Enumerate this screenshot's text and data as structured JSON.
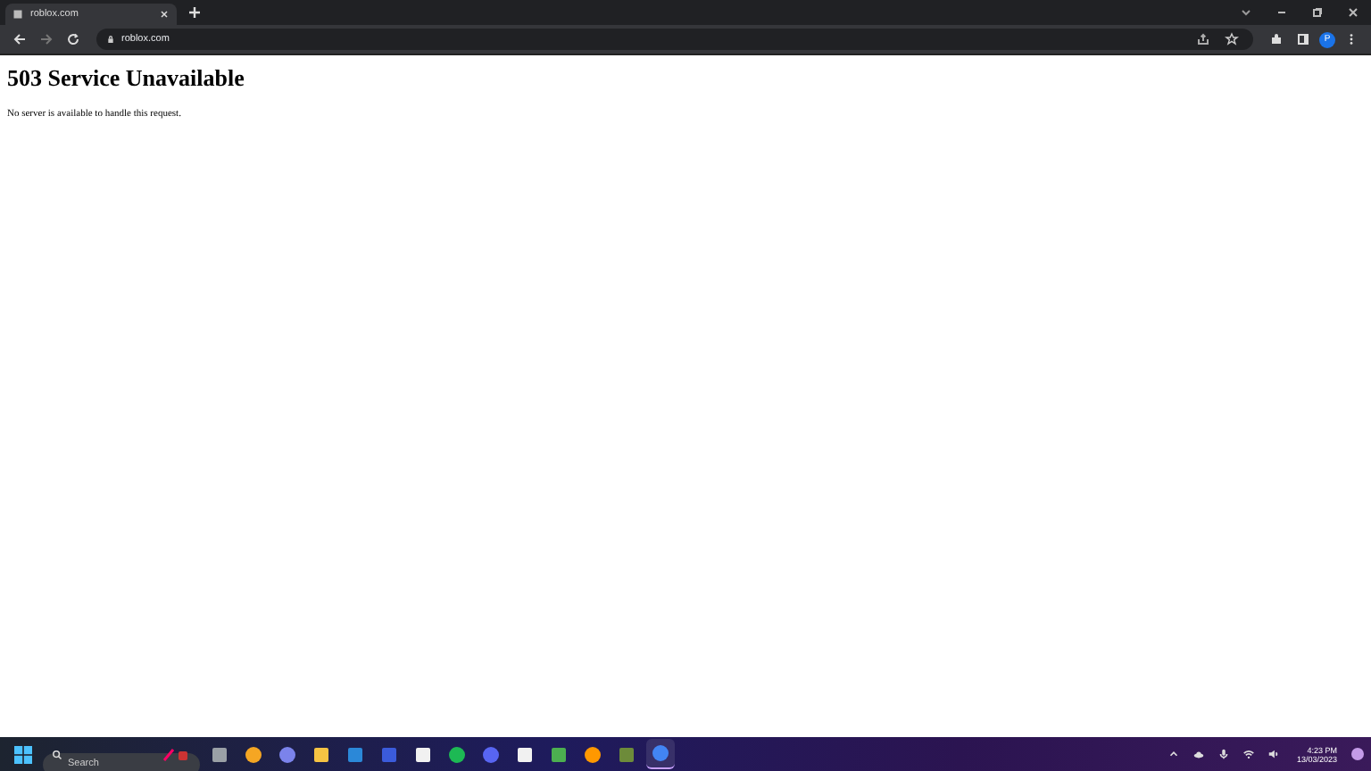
{
  "tabs": [
    {
      "title": "roblox.com",
      "selected": true
    }
  ],
  "address_bar": {
    "value": "roblox.com"
  },
  "profile": {
    "initial": "P"
  },
  "page": {
    "heading": "503 Service Unavailable",
    "message": "No server is available to handle this request."
  },
  "taskbar": {
    "search": {
      "placeholder": "Search"
    },
    "apps": [
      {
        "kind": "taskview",
        "selected": false
      },
      {
        "kind": "weather",
        "selected": false
      },
      {
        "kind": "chat",
        "selected": false
      },
      {
        "kind": "folder",
        "selected": false
      },
      {
        "kind": "store",
        "selected": false
      },
      {
        "kind": "editor",
        "selected": false
      },
      {
        "kind": "file",
        "selected": false
      },
      {
        "kind": "music",
        "selected": false
      },
      {
        "kind": "discord",
        "selected": false
      },
      {
        "kind": "file",
        "selected": false
      },
      {
        "kind": "vpn",
        "selected": false
      },
      {
        "kind": "browser",
        "selected": false
      },
      {
        "kind": "game",
        "selected": false
      },
      {
        "kind": "chrome",
        "selected": true
      }
    ],
    "time": "4:23 PM",
    "date": "13/03/2023"
  }
}
